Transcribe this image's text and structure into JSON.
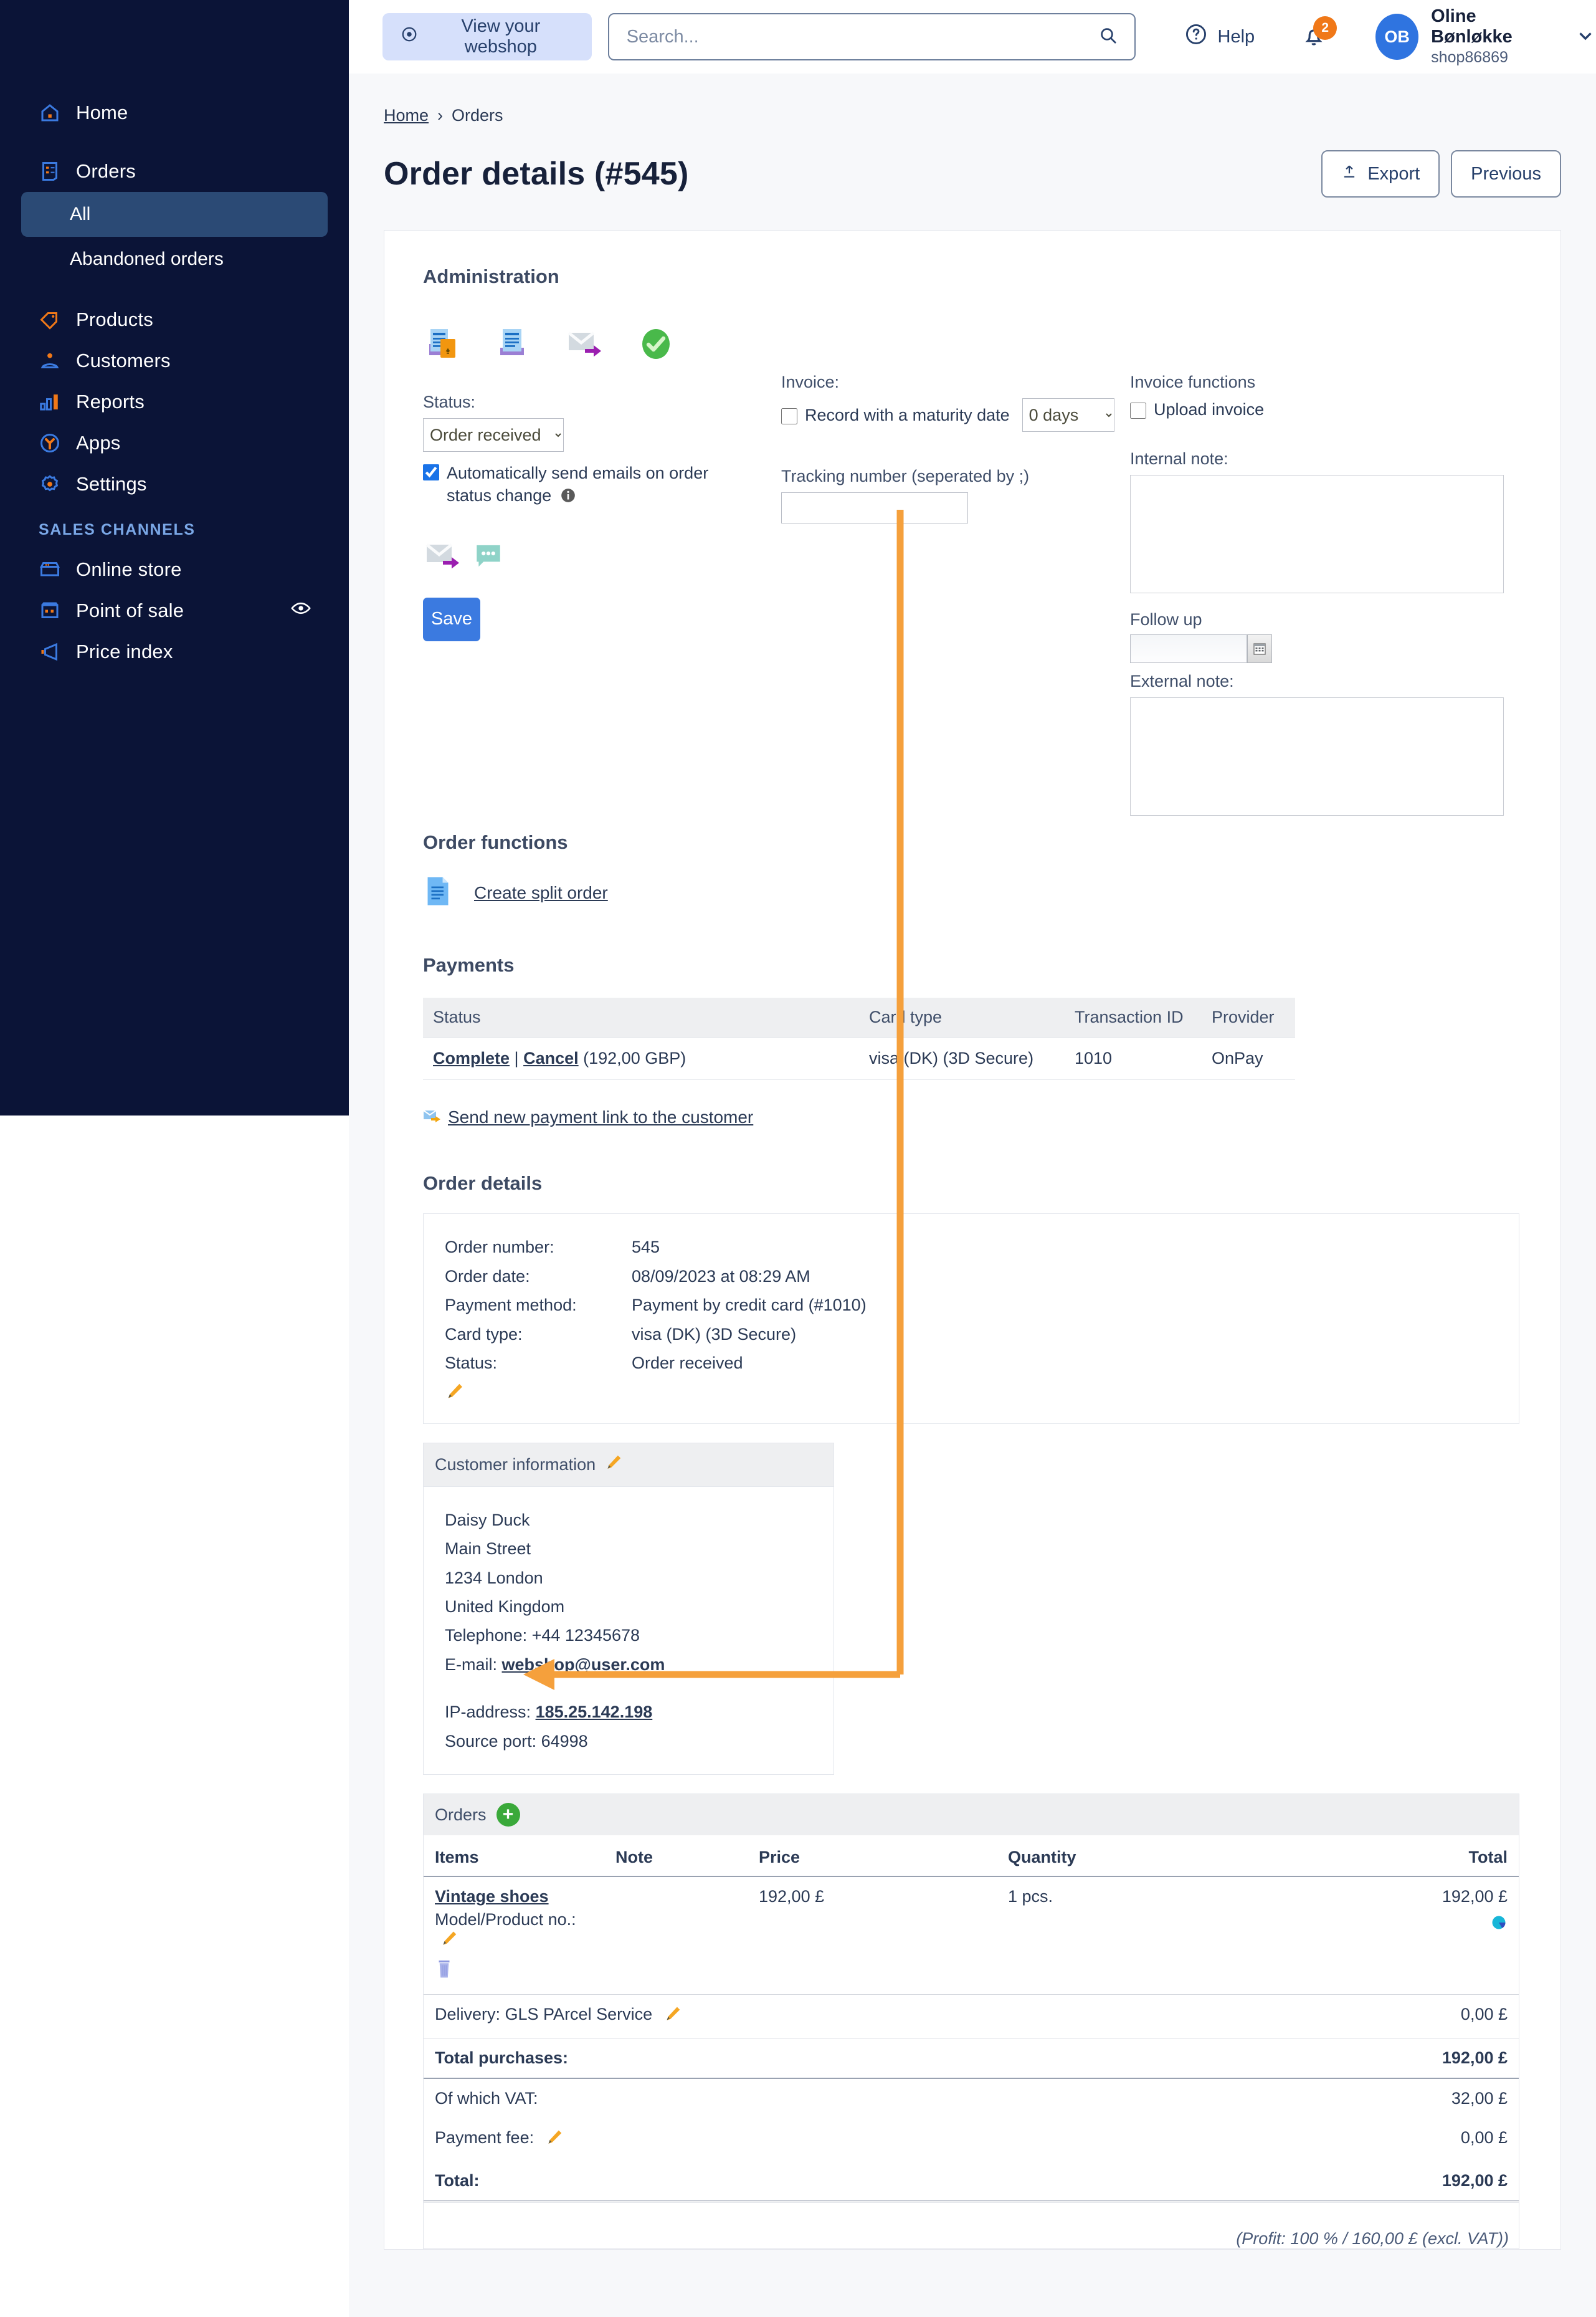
{
  "topbar": {
    "webshop_button": "View your webshop",
    "search_placeholder": "Search...",
    "search_value": "",
    "help_label": "Help",
    "notification_count": "2",
    "avatar_initials": "OB",
    "user_name": "Oline Bønløkke",
    "shop_id": "shop86869"
  },
  "sidebar": {
    "items": [
      {
        "label": "Home",
        "icon": "home-icon"
      },
      {
        "label": "Orders",
        "icon": "orders-icon"
      },
      {
        "label": "Products",
        "icon": "tag-icon"
      },
      {
        "label": "Customers",
        "icon": "customer-icon"
      },
      {
        "label": "Reports",
        "icon": "chart-icon"
      },
      {
        "label": "Apps",
        "icon": "apps-icon"
      },
      {
        "label": "Settings",
        "icon": "gear-icon"
      }
    ],
    "orders_sub": [
      {
        "label": "All",
        "active": true
      },
      {
        "label": "Abandoned orders",
        "active": false
      }
    ],
    "sales_channels_header": "SALES CHANNELS",
    "sales_channels": [
      {
        "label": "Online store",
        "icon": "store-icon",
        "eye": false
      },
      {
        "label": "Point of sale",
        "icon": "pos-icon",
        "eye": true
      },
      {
        "label": "Price index",
        "icon": "megaphone-icon",
        "eye": false
      }
    ]
  },
  "breadcrumb": {
    "home": "Home",
    "separator": "›",
    "current": "Orders"
  },
  "page": {
    "title": "Order details (#545)",
    "export_button": "Export",
    "previous_button": "Previous"
  },
  "administration": {
    "heading": "Administration",
    "icons": [
      "invoice-card-icon",
      "invoice-icon",
      "send-email-icon",
      "approve-check-icon"
    ],
    "status_label": "Status:",
    "status_value": "Order received",
    "status_options": [
      "Order received"
    ],
    "auto_email_label": "Automatically send emails on order status change",
    "auto_email_checked": true,
    "secondary_icons": [
      "send-email-icon",
      "comment-icon"
    ],
    "save_button": "Save",
    "invoice_label": "Invoice:",
    "maturity_label": "Record with a maturity date",
    "maturity_checked": false,
    "maturity_days_value": "0 days",
    "maturity_days_options": [
      "0 days"
    ],
    "tracking_label": "Tracking number (seperated by ;)",
    "tracking_value": "",
    "invoice_functions_label": "Invoice functions",
    "upload_invoice_label": "Upload invoice",
    "upload_invoice_checked": false,
    "internal_note_label": "Internal note:",
    "internal_note_value": "",
    "follow_up_label": "Follow up",
    "follow_up_value": "",
    "external_note_label": "External note:",
    "external_note_value": ""
  },
  "order_functions": {
    "heading": "Order functions",
    "split_order_link": "Create split order"
  },
  "payments": {
    "heading": "Payments",
    "columns": [
      "Status",
      "Card type",
      "Transaction ID",
      "Provider"
    ],
    "rows": [
      {
        "complete_link": "Complete",
        "divider": "|",
        "cancel_link": "Cancel",
        "amount": "(192,00 GBP)",
        "card_type": "visa (DK) (3D Secure)",
        "transaction_id": "1010",
        "provider": "OnPay"
      }
    ],
    "payment_link_label": "Send new payment link to the customer"
  },
  "order_details": {
    "heading": "Order details",
    "rows": [
      {
        "key": "Order number:",
        "value": "545"
      },
      {
        "key": "Order date:",
        "value": "08/09/2023 at 08:29 AM"
      },
      {
        "key": "Payment method:",
        "value": "Payment by credit card (#1010)"
      },
      {
        "key": "Card type:",
        "value": "visa (DK) (3D Secure)"
      },
      {
        "key": "Status:",
        "value": "Order received"
      }
    ]
  },
  "customer_information": {
    "heading": "Customer information",
    "name": "Daisy Duck",
    "street": "Main Street",
    "city": "1234 London",
    "country": "United Kingdom",
    "telephone": "Telephone: +44 12345678",
    "email_label": "E-mail: ",
    "email": "webshop@user.com",
    "ip_label": "IP-address: ",
    "ip": "185.25.142.198",
    "source_port": "Source port: 64998"
  },
  "items": {
    "heading": "Orders",
    "add_icon_label": "+",
    "columns": [
      "Items",
      "Note",
      "Price",
      "Quantity",
      "Total"
    ],
    "rows": [
      {
        "name": "Vintage shoes",
        "model_label": "Model/Product no.:",
        "note": "",
        "price": "192,00 £",
        "quantity": "1 pcs.",
        "total": "192,00 £"
      }
    ],
    "delivery_label": "Delivery: GLS PArcel Service",
    "delivery_total": "0,00 £",
    "total_purchases_label": "Total purchases:",
    "total_purchases_value": "192,00 £",
    "vat_label": "Of which VAT:",
    "vat_value": "32,00 £",
    "payment_fee_label": "Payment fee:",
    "payment_fee_value": "0,00 £",
    "total_label": "Total:",
    "total_value": "192,00 £",
    "profit_note": "(Profit: 100 % / 160,00 £ (excl. VAT))"
  },
  "annotation": {
    "color": "#F5A03C"
  }
}
